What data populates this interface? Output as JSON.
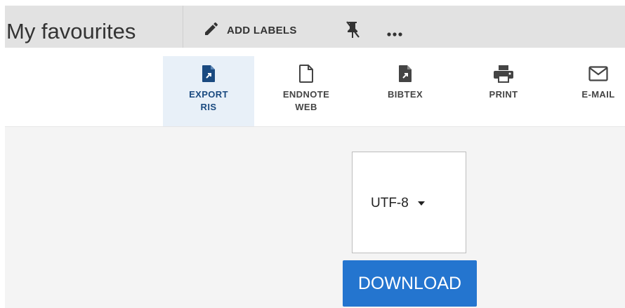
{
  "header": {
    "title": "My favourites",
    "add_labels": "ADD LABELS",
    "unpin_icon": "unpin-icon",
    "more_icon": "more-dots-icon"
  },
  "toolbar": {
    "items": [
      {
        "line1": "EXPORT",
        "line2": "RIS",
        "icon": "file-export-icon",
        "active": true
      },
      {
        "line1": "ENDNOTE",
        "line2": "WEB",
        "icon": "file-outline-icon",
        "active": false
      },
      {
        "line1": "BIBTEX",
        "line2": "",
        "icon": "file-export-icon",
        "active": false
      },
      {
        "line1": "PRINT",
        "line2": "",
        "icon": "printer-icon",
        "active": false
      },
      {
        "line1": "E-MAIL",
        "line2": "",
        "icon": "envelope-icon",
        "active": false
      }
    ]
  },
  "export": {
    "encoding_value": "UTF-8",
    "download_label": "DOWNLOAD"
  },
  "colors": {
    "accent": "#2475cf",
    "active_tab_bg": "#e8f0f8",
    "active_icon": "#1a4a80",
    "header_bg": "#e2e2e2",
    "content_bg": "#f4f4f4"
  }
}
